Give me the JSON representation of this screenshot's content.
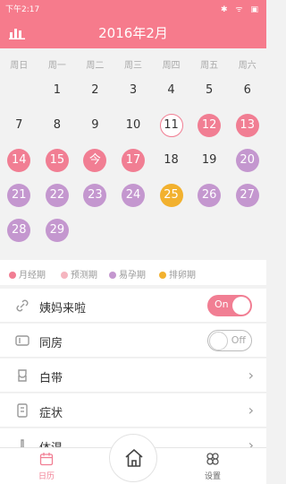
{
  "statusbar": {
    "time": "下午2:17",
    "icons": "✱ ᯤ ▣"
  },
  "header": {
    "title": "2016年2月",
    "stats_icon": "bar-chart-icon"
  },
  "calendar": {
    "weekdays": [
      "周日",
      "周一",
      "周二",
      "周三",
      "周四",
      "周五",
      "周六"
    ],
    "days": [
      {
        "label": "1",
        "type": "normal"
      },
      {
        "label": "2",
        "type": "normal"
      },
      {
        "label": "3",
        "type": "normal"
      },
      {
        "label": "4",
        "type": "normal"
      },
      {
        "label": "5",
        "type": "normal"
      },
      {
        "label": "6",
        "type": "normal"
      },
      {
        "label": "7",
        "type": "normal"
      },
      {
        "label": "8",
        "type": "normal"
      },
      {
        "label": "9",
        "type": "normal"
      },
      {
        "label": "10",
        "type": "normal"
      },
      {
        "label": "11",
        "type": "today"
      },
      {
        "label": "12",
        "type": "period"
      },
      {
        "label": "13",
        "type": "period"
      },
      {
        "label": "14",
        "type": "period"
      },
      {
        "label": "15",
        "type": "period"
      },
      {
        "label": "今",
        "type": "period"
      },
      {
        "label": "17",
        "type": "period"
      },
      {
        "label": "18",
        "type": "normal"
      },
      {
        "label": "19",
        "type": "normal"
      },
      {
        "label": "20",
        "type": "fertile"
      },
      {
        "label": "21",
        "type": "fertile"
      },
      {
        "label": "22",
        "type": "fertile"
      },
      {
        "label": "23",
        "type": "fertile"
      },
      {
        "label": "24",
        "type": "fertile"
      },
      {
        "label": "25",
        "type": "ovulation"
      },
      {
        "label": "26",
        "type": "fertile"
      },
      {
        "label": "27",
        "type": "fertile"
      },
      {
        "label": "28",
        "type": "fertile"
      },
      {
        "label": "29",
        "type": "fertile"
      }
    ],
    "first_weekday": 1
  },
  "legend": [
    {
      "label": "月经期",
      "color": "#f17e93"
    },
    {
      "label": "预测期",
      "color": "#f5b5bf"
    },
    {
      "label": "易孕期",
      "color": "#c497cf"
    },
    {
      "label": "排卵期",
      "color": "#f2b12f"
    }
  ],
  "rows": [
    {
      "label": "姨妈来啦",
      "icon": "link-icon",
      "control": "toggle",
      "state": "On"
    },
    {
      "label": "同房",
      "icon": "couple-icon",
      "control": "toggle",
      "state": "Off"
    },
    {
      "label": "白带",
      "icon": "discharge-icon",
      "control": "chevron"
    },
    {
      "label": "症状",
      "icon": "symptom-icon",
      "control": "chevron"
    },
    {
      "label": "体温",
      "icon": "thermometer-icon",
      "control": "chevron"
    }
  ],
  "tabs": {
    "calendar_label": "日历",
    "settings_label": "设置"
  },
  "colors": {
    "brand": "#f67b8c",
    "fertile": "#c497cf",
    "ovulation": "#f2b12f"
  }
}
